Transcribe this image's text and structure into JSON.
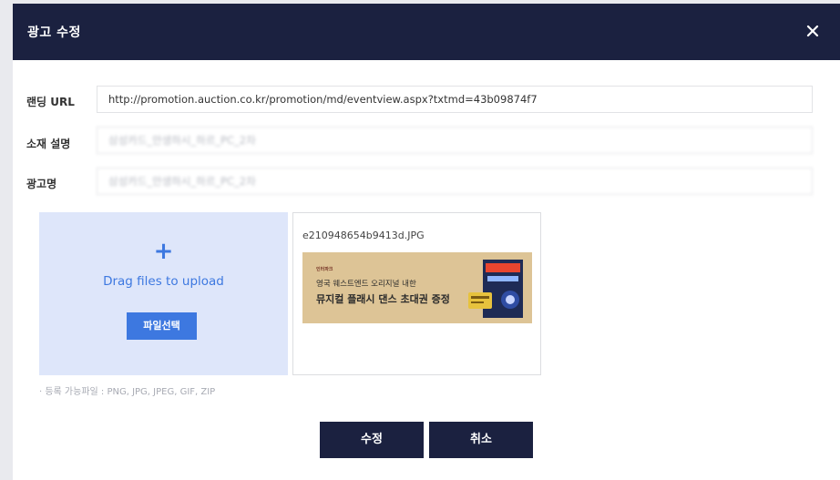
{
  "modal": {
    "title": "광고 수정",
    "close_icon": "close-icon"
  },
  "form": {
    "landing_url": {
      "label": "랜딩 URL",
      "value": "http://promotion.auction.co.kr/promotion/md/eventview.aspx?txtmd=43b09874f7"
    },
    "material_desc": {
      "label": "소재 설명",
      "value": "삼성카드_안생하시_하르_PC_2차"
    },
    "ad_name": {
      "label": "광고명",
      "value": "삼성카드_안생하시_하르_PC_2차"
    }
  },
  "upload": {
    "plus_icon": "+",
    "drag_text": "Drag files to upload",
    "select_button": "파일선택",
    "hint": "· 등록 가능파일 : PNG, JPG, JPEG, GIF, ZIP"
  },
  "preview": {
    "filename": "e210948654b9413d.JPG",
    "banner": {
      "brand": "인터파크",
      "line1": "영국 웨스트엔드 오리지널 내한",
      "line2": "뮤지컬 플래시 댄스 초대권 증정"
    }
  },
  "actions": {
    "submit": "수정",
    "cancel": "취소"
  },
  "colors": {
    "header_bg": "#1b2140",
    "accent": "#3d78e0",
    "dropzone_bg": "#dee6fa"
  }
}
